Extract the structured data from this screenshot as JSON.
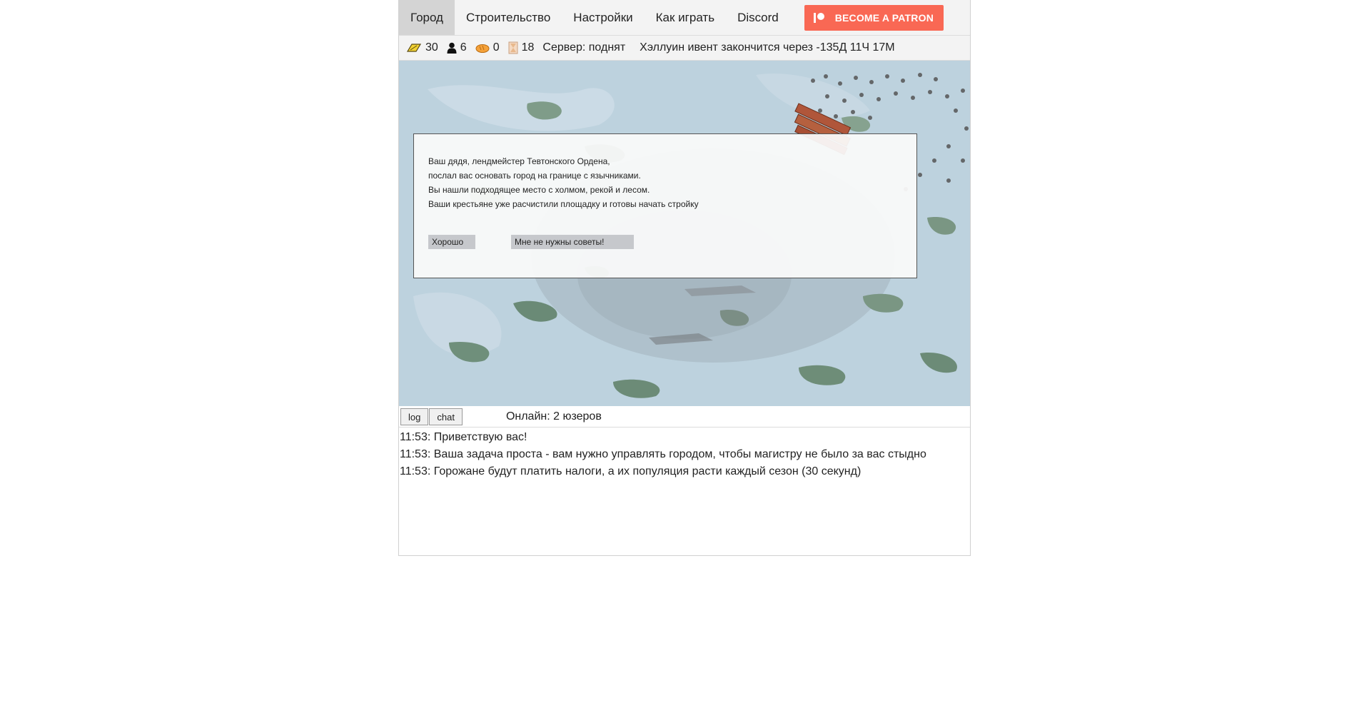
{
  "nav": {
    "tabs": [
      {
        "label": "Город",
        "active": true
      },
      {
        "label": "Строительство"
      },
      {
        "label": "Настройки"
      },
      {
        "label": "Как играть"
      },
      {
        "label": "Discord"
      }
    ],
    "patron_label": "BECOME A PATRON",
    "patron_color": "#f96854"
  },
  "status": {
    "gold": "30",
    "gold_icon": "gold-icon",
    "population": "6",
    "population_icon": "person-icon",
    "food": "0",
    "food_icon": "bread-icon",
    "time": "18",
    "time_icon": "hourglass-icon",
    "server": "Сервер: поднят",
    "event": "Хэллуин ивент закончится через -135Д 11Ч 17М"
  },
  "dialog": {
    "lines": [
      "Ваш дядя, лендмейстер Тевтонского Ордена,",
      "послал вас основать город на границе с язычниками.",
      "Вы нашли подходящее место с холмом, рекой и лесом.",
      "Ваши крестьяне уже расчистили площадку и готовы начать стройку"
    ],
    "ok_label": "Хорошо",
    "no_advice_label": "Мне не нужны советы!"
  },
  "tabs": {
    "log_label": "log",
    "chat_label": "chat",
    "online": "Онлайн: 2 юзеров"
  },
  "log": [
    "11:53: Приветствую вас!",
    "11:53: Ваша задача проста - вам нужно управлять городом, чтобы магистру не было за вас стыдно",
    "11:53: Горожане будут платить налоги, а их популяция расти каждый сезон (30 секунд)"
  ]
}
